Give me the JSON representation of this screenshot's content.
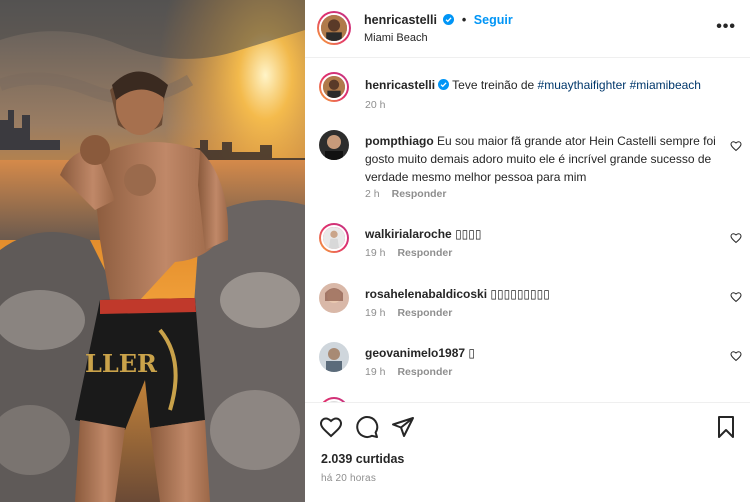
{
  "post": {
    "username": "henricastelli",
    "follow_label": "Seguir",
    "separator": "•",
    "location": "Miami Beach",
    "more_label": "•••",
    "icons": {
      "more": "more-options-icon",
      "verified": "verified-badge-icon",
      "like": "heart-icon",
      "comment": "comment-icon",
      "share": "send-icon",
      "save": "bookmark-icon"
    },
    "colors": {
      "link": "#0095f6",
      "hashtag": "#00376b",
      "muted": "#8e8e8e"
    }
  },
  "caption": {
    "username": "henricastelli",
    "text": "Teve treinão de ",
    "hashtag1": "#muaythaifighter",
    "hashtag2": "#miamibeach",
    "time": "20 h"
  },
  "comments": [
    {
      "username": "pompthiago",
      "text": "Eu sou maior fã grande ator Hein Castelli sempre foi gosto muito demais adoro muito ele é incrível grande sucesso de verdade mesmo melhor pessoa para mim",
      "time": "2 h",
      "reply": "Responder"
    },
    {
      "username": "walkirialaroche",
      "text": "▯▯▯▯",
      "time": "19 h",
      "reply": "Responder"
    },
    {
      "username": "rosahelenabaldicoski",
      "text": "▯▯▯▯▯▯▯▯▯",
      "time": "19 h",
      "reply": "Responder"
    },
    {
      "username": "geovanimelo1987",
      "text": "▯",
      "time": "19 h",
      "reply": "Responder"
    }
  ],
  "stats": {
    "likes": "2.039 curtidas",
    "posted": "há 20 horas"
  }
}
